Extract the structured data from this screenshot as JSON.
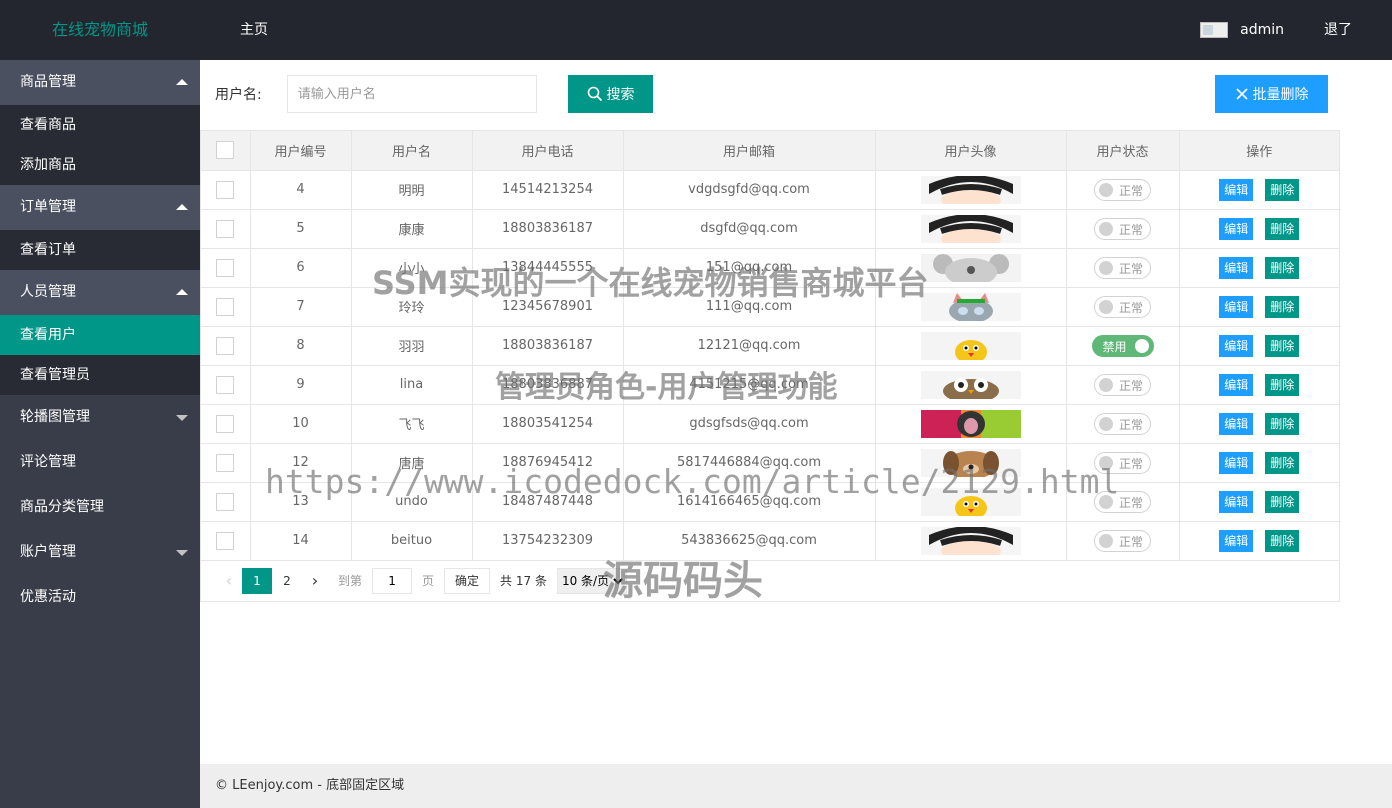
{
  "header": {
    "logo": "在线宠物商城",
    "nav_home": "主页",
    "username": "admin",
    "logout": "退了"
  },
  "sidebar": {
    "groups": [
      {
        "label": "商品管理",
        "expanded": true,
        "items": [
          "查看商品",
          "添加商品"
        ]
      },
      {
        "label": "订单管理",
        "expanded": true,
        "items": [
          "查看订单"
        ]
      },
      {
        "label": "人员管理",
        "expanded": true,
        "items": [
          "查看用户",
          "查看管理员"
        ]
      },
      {
        "label": "轮播图管理",
        "expanded": false
      },
      {
        "label": "评论管理"
      },
      {
        "label": "商品分类管理"
      },
      {
        "label": "账户管理",
        "expanded": false
      },
      {
        "label": "优惠活动"
      }
    ],
    "active_item": "查看用户"
  },
  "search": {
    "label": "用户名:",
    "placeholder": "请输入用户名",
    "button": "搜索",
    "batch_delete": "批量删除"
  },
  "table": {
    "columns": [
      "用户编号",
      "用户名",
      "用户电话",
      "用户邮箱",
      "用户头像",
      "用户状态",
      "操作"
    ],
    "rows": [
      {
        "id": "4",
        "name": "明明",
        "phone": "14514213254",
        "email": "vdgdsgfd@qq.com",
        "avatar": "boy-icon",
        "status": "正常",
        "on": false
      },
      {
        "id": "5",
        "name": "康康",
        "phone": "18803836187",
        "email": "dsgfd@qq.com",
        "avatar": "boy-icon",
        "status": "正常",
        "on": false
      },
      {
        "id": "6",
        "name": "小小",
        "phone": "13844445555",
        "email": "151@qq.com",
        "avatar": "koala-icon",
        "status": "正常",
        "on": false
      },
      {
        "id": "7",
        "name": "玲玲",
        "phone": "12345678901",
        "email": "111@qq.com",
        "avatar": "cat-icon",
        "status": "正常",
        "on": false
      },
      {
        "id": "8",
        "name": "羽羽",
        "phone": "18803836187",
        "email": "12121@qq.com",
        "avatar": "chick-icon",
        "status": "禁用",
        "on": true
      },
      {
        "id": "9",
        "name": "lina",
        "phone": "18803836887",
        "email": "4151215@qq.com",
        "avatar": "owl-icon",
        "status": "正常",
        "on": false
      },
      {
        "id": "10",
        "name": "飞飞",
        "phone": "18803541254",
        "email": "gdsgfsds@qq.com",
        "avatar": "girl-photo-icon",
        "status": "正常",
        "on": false
      },
      {
        "id": "12",
        "name": "唐唐",
        "phone": "18876945412",
        "email": "5817446884@qq.com",
        "avatar": "dog-icon",
        "status": "正常",
        "on": false
      },
      {
        "id": "13",
        "name": "undo",
        "phone": "18487487448",
        "email": "1614166465@qq.com",
        "avatar": "chick-icon",
        "status": "正常",
        "on": false
      },
      {
        "id": "14",
        "name": "beituo",
        "phone": "13754232309",
        "email": "543836625@qq.com",
        "avatar": "boy-icon",
        "status": "正常",
        "on": false
      }
    ],
    "edit_label": "编辑",
    "delete_label": "删除"
  },
  "pager": {
    "pages": [
      "1",
      "2"
    ],
    "current": "1",
    "goto_label": "到第",
    "goto_value": "1",
    "page_unit": "页",
    "confirm": "确定",
    "total": "共 17 条",
    "page_size": "10 条/页"
  },
  "footer": "© LEenjoy.com - 底部固定区域",
  "watermarks": [
    "SSM实现的一个在线宠物销售商城平台",
    "管理员角色-用户管理功能",
    "https://www.icodedock.com/article/2129.html",
    "源码码头"
  ],
  "colors": {
    "header_bg": "#23262e",
    "sidebar_bg": "#393d49",
    "accent": "#009688",
    "blue": "#1e9fff",
    "switch_on": "#5fb878"
  }
}
